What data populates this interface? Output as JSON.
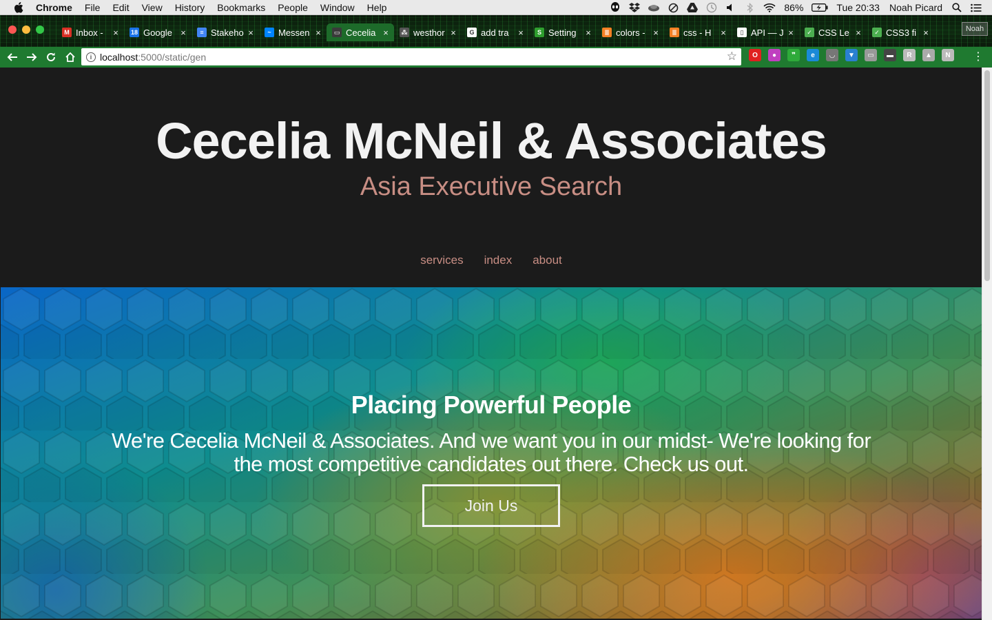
{
  "menubar": {
    "app": "Chrome",
    "items": [
      "File",
      "Edit",
      "View",
      "History",
      "Bookmarks",
      "People",
      "Window",
      "Help"
    ],
    "battery": "86%",
    "clock": "Tue 20:33",
    "user": "Noah Picard"
  },
  "tabs": [
    {
      "label": "Inbox -",
      "icon": "gmail-icon",
      "color": "#d93025",
      "glyph": "M",
      "active": false
    },
    {
      "label": "Google",
      "icon": "calendar-icon",
      "color": "#1a73e8",
      "glyph": "18",
      "active": false
    },
    {
      "label": "Stakeho",
      "icon": "docs-icon",
      "color": "#4285f4",
      "glyph": "≡",
      "active": false
    },
    {
      "label": "Messen",
      "icon": "messenger-icon",
      "color": "#0084ff",
      "glyph": "~",
      "active": false
    },
    {
      "label": "Cecelia",
      "icon": "page-icon",
      "color": "#3a3a3a",
      "glyph": "▭",
      "active": true
    },
    {
      "label": "westhor",
      "icon": "network-icon",
      "color": "#555555",
      "glyph": "⁂",
      "active": false
    },
    {
      "label": "add tra",
      "icon": "google-icon",
      "color": "#ffffff",
      "glyph": "G",
      "active": false
    },
    {
      "label": "Setting",
      "icon": "settings-app-icon",
      "color": "#2e9e2e",
      "glyph": "S",
      "active": false
    },
    {
      "label": "colors -",
      "icon": "stackoverflow-icon",
      "color": "#f48024",
      "glyph": "≣",
      "active": false
    },
    {
      "label": "css - H",
      "icon": "stackoverflow-icon",
      "color": "#f48024",
      "glyph": "≣",
      "active": false
    },
    {
      "label": "API — J",
      "icon": "document-icon",
      "color": "#ffffff",
      "glyph": "▯",
      "active": false
    },
    {
      "label": "CSS Le",
      "icon": "chart-app-icon",
      "color": "#4caf50",
      "glyph": "✓",
      "active": false
    },
    {
      "label": "CSS3 fi",
      "icon": "chart-app-icon",
      "color": "#4caf50",
      "glyph": "✓",
      "active": false
    }
  ],
  "profile_label": "Noah",
  "address": {
    "host": "localhost",
    "path": ":5000/static/gen"
  },
  "extensions": [
    {
      "name": "opera-icon",
      "color": "#e02020",
      "glyph": "O"
    },
    {
      "name": "color-wheel-icon",
      "color": "#c040c0",
      "glyph": "●"
    },
    {
      "name": "quote-icon",
      "color": "#2eaa3a",
      "glyph": "❞"
    },
    {
      "name": "edge-icon",
      "color": "#1a8ad8",
      "glyph": "e"
    },
    {
      "name": "pocket-icon",
      "color": "#777777",
      "glyph": "◡"
    },
    {
      "name": "shield-icon",
      "color": "#2a80d0",
      "glyph": "▼"
    },
    {
      "name": "toggle-icon",
      "color": "#999999",
      "glyph": "▭"
    },
    {
      "name": "screen-icon",
      "color": "#444444",
      "glyph": "▬"
    },
    {
      "name": "r-icon",
      "color": "#bbbbbb",
      "glyph": "R"
    },
    {
      "name": "drive-icon",
      "color": "#aaaaaa",
      "glyph": "▲"
    },
    {
      "name": "n-icon",
      "color": "#bbbbbb",
      "glyph": "N"
    }
  ],
  "site": {
    "title": "Cecelia McNeil & Associates",
    "subtitle": "Asia Executive Search",
    "nav": [
      "services",
      "index",
      "about"
    ]
  },
  "banner": {
    "title": "Placing Powerful People",
    "text": "We're Cecelia McNeil & Associates. And we want you in our midst- We're looking for the most competitive candidates out there. Check us out.",
    "button": "Join Us"
  },
  "colors": {
    "accent": "#c88e84",
    "toolbar": "#1f7a30",
    "page_bg": "#1b1b1b"
  }
}
